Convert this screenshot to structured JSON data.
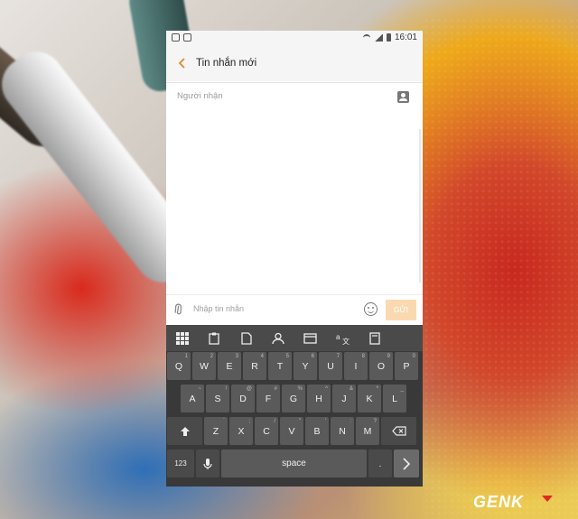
{
  "status_bar": {
    "time": "16:01"
  },
  "header": {
    "back_icon": "chevron-left-icon",
    "title": "Tin nhắn mới"
  },
  "recipient": {
    "placeholder": "Người nhận",
    "contact_icon": "contact-book-icon"
  },
  "composer": {
    "placeholder": "Nhập tin nhắn",
    "send_label": "GỬI",
    "attach_icon": "paperclip-icon",
    "emoji_icon": "smiley-icon"
  },
  "keyboard": {
    "toolbar_icons": [
      "grid-icon",
      "clipboard-icon",
      "document-icon",
      "person-icon",
      "window-icon",
      "translate-icon",
      "book-icon"
    ],
    "row1": [
      {
        "k": "Q",
        "s": "1"
      },
      {
        "k": "W",
        "s": "2"
      },
      {
        "k": "E",
        "s": "3"
      },
      {
        "k": "R",
        "s": "4"
      },
      {
        "k": "T",
        "s": "5"
      },
      {
        "k": "Y",
        "s": "6"
      },
      {
        "k": "U",
        "s": "7"
      },
      {
        "k": "I",
        "s": "8"
      },
      {
        "k": "O",
        "s": "9"
      },
      {
        "k": "P",
        "s": "0"
      }
    ],
    "row2": [
      {
        "k": "A",
        "s": "~"
      },
      {
        "k": "S",
        "s": "!"
      },
      {
        "k": "D",
        "s": "@"
      },
      {
        "k": "F",
        "s": "#"
      },
      {
        "k": "G",
        "s": "%"
      },
      {
        "k": "H",
        "s": "^"
      },
      {
        "k": "J",
        "s": "&"
      },
      {
        "k": "K",
        "s": "*"
      },
      {
        "k": "L",
        "s": "_"
      }
    ],
    "row3": [
      {
        "k": "Z",
        "s": "`"
      },
      {
        "k": "X",
        "s": ";"
      },
      {
        "k": "C",
        "s": "/"
      },
      {
        "k": "V",
        "s": "\""
      },
      {
        "k": "B",
        "s": "'"
      },
      {
        "k": "N",
        "s": ":"
      },
      {
        "k": "M",
        "s": "?"
      }
    ],
    "shift_icon": "shift-arrow-icon",
    "backspace_icon": "backspace-icon",
    "num_label": "123",
    "space_label": "space",
    "period_label": ".",
    "mic_icon": "microphone-icon",
    "enter_icon": "chevron-right-icon"
  },
  "watermark": "GENK"
}
